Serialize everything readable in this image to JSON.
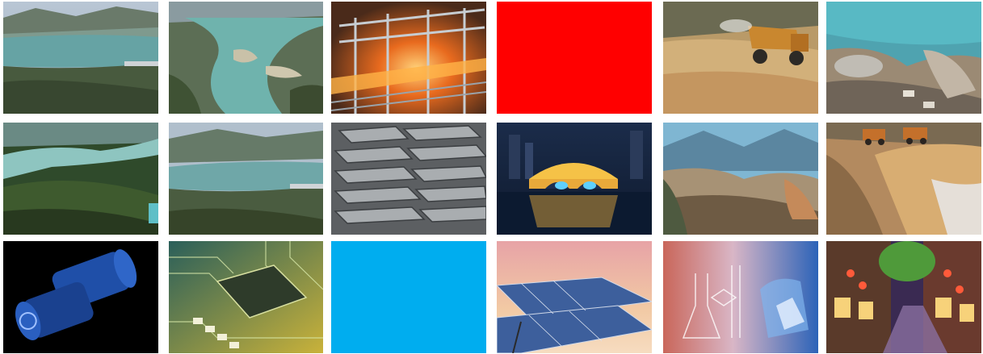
{
  "gallery": {
    "tiles": [
      {
        "subject": "river-valley-dam",
        "kind": "photo"
      },
      {
        "subject": "river-islands-aerial",
        "kind": "photo"
      },
      {
        "subject": "steel-mill-hot-strip",
        "kind": "photo"
      },
      {
        "subject": "solid-color",
        "kind": "color",
        "color": "#ff0000"
      },
      {
        "subject": "mining-dump-truck",
        "kind": "photo"
      },
      {
        "subject": "open-pit-mine-smoke",
        "kind": "photo"
      },
      {
        "subject": "river-forest-aerial",
        "kind": "photo"
      },
      {
        "subject": "river-valley-dam-2",
        "kind": "photo"
      },
      {
        "subject": "metal-ingot-stack",
        "kind": "photo"
      },
      {
        "subject": "night-bridge-lights",
        "kind": "photo"
      },
      {
        "subject": "mountain-mine-valley",
        "kind": "photo"
      },
      {
        "subject": "quarry-trucks",
        "kind": "photo"
      },
      {
        "subject": "blue-metal-cylinders",
        "kind": "photo"
      },
      {
        "subject": "circuit-board-chip",
        "kind": "photo"
      },
      {
        "subject": "solid-color",
        "kind": "color",
        "color": "#00adef"
      },
      {
        "subject": "solar-panels-sunset",
        "kind": "photo"
      },
      {
        "subject": "laboratory-glassware",
        "kind": "photo"
      },
      {
        "subject": "night-street-lanterns",
        "kind": "photo"
      }
    ]
  }
}
